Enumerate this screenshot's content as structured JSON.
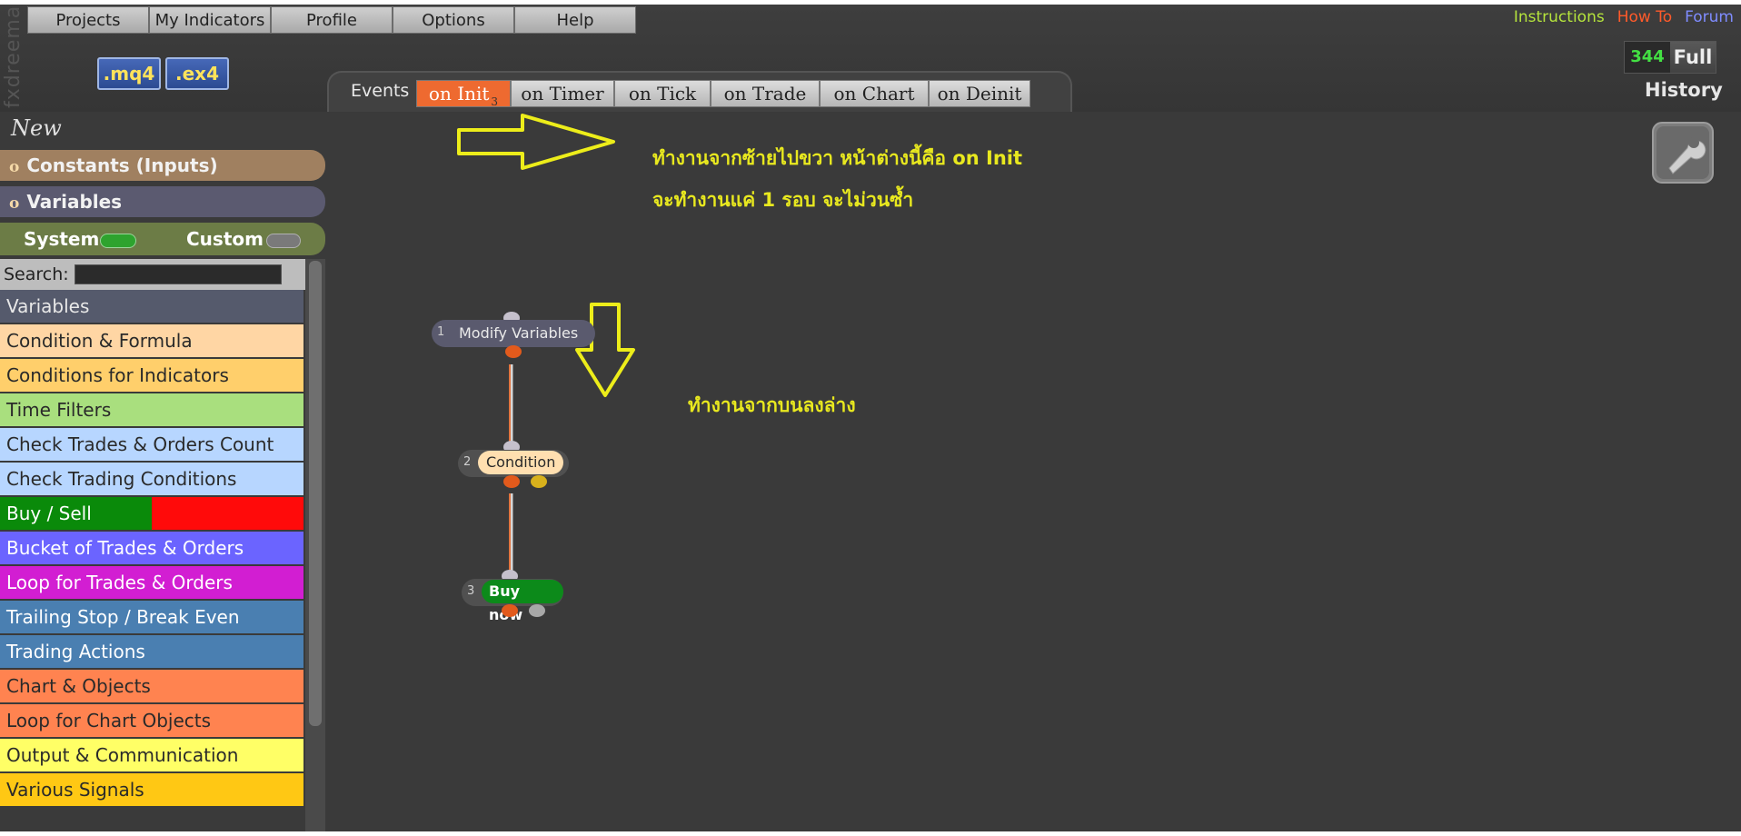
{
  "brand": "fxdreema",
  "menu": [
    "Projects",
    "My Indicators",
    "Profile",
    "Options",
    "Help"
  ],
  "format_buttons": [
    ".mq4",
    ".ex4"
  ],
  "top_links": [
    {
      "label": "Instructions",
      "color": "#b5e43c"
    },
    {
      "label": "How To",
      "color": "#ff5a2a"
    },
    {
      "label": "Forum",
      "color": "#7f8cff"
    }
  ],
  "counter": {
    "value": "344",
    "label": "Full"
  },
  "history_label": "History",
  "events": {
    "label": "Events",
    "tabs": [
      {
        "label": "on Init",
        "sub": "3",
        "active": true
      },
      {
        "label": "on Timer"
      },
      {
        "label": "on Tick"
      },
      {
        "label": "on Trade"
      },
      {
        "label": "on Chart"
      },
      {
        "label": "on Deinit"
      }
    ]
  },
  "sidebar": {
    "new_label": "New",
    "constants_label": "Constants (Inputs)",
    "variables_label": "Variables",
    "section_bullet": "o",
    "toggles": {
      "system": "System",
      "system_on": true,
      "custom": "Custom",
      "custom_on": false
    },
    "search": {
      "label": "Search:",
      "value": ""
    },
    "categories": [
      {
        "label": "Variables",
        "bg": "#555a6c",
        "color": "#e8e8e8"
      },
      {
        "label": "Condition & Formula",
        "bg": "#ffd6a4",
        "color": "#2a2a2a"
      },
      {
        "label": "Conditions for Indicators",
        "bg": "#ffcf6b",
        "color": "#2a2a2a"
      },
      {
        "label": "Time Filters",
        "bg": "#a9df7e",
        "color": "#2a2a2a"
      },
      {
        "label": "Check Trades & Orders Count",
        "bg": "#b7d6ff",
        "color": "#2a2a2a"
      },
      {
        "label": "Check Trading Conditions",
        "bg": "#b7d6ff",
        "color": "#2a2a2a"
      },
      {
        "label": "Buy / Sell",
        "bg": "#0a8a0a",
        "color": "#ffffff",
        "split_bg": "#ff0a0a"
      },
      {
        "label": "Bucket of Trades & Orders",
        "bg": "#6b64ff",
        "color": "#ffffff"
      },
      {
        "label": "Loop for Trades & Orders",
        "bg": "#d21ed2",
        "color": "#ffffff"
      },
      {
        "label": "Trailing Stop / Break Even",
        "bg": "#4a7fb1",
        "color": "#ffffff"
      },
      {
        "label": "Trading Actions",
        "bg": "#4a7fb1",
        "color": "#ffffff"
      },
      {
        "label": "Chart & Objects",
        "bg": "#ff8350",
        "color": "#2a2a2a"
      },
      {
        "label": "Loop for Chart Objects",
        "bg": "#ff8350",
        "color": "#2a2a2a"
      },
      {
        "label": "Output & Communication",
        "bg": "#ffff66",
        "color": "#2a2a2a"
      },
      {
        "label": "Various Signals",
        "bg": "#ffc814",
        "color": "#2a2a2a"
      }
    ]
  },
  "canvas": {
    "annotation_right": [
      "ทำงานจากซ้ายไปขวา หน้าต่างนี้คือ on Init",
      "จะทำงานแค่ 1 รอบ จะไม่วนซ้ำ"
    ],
    "annotation_down": "ทำงานจากบนลงล่าง",
    "nodes": [
      {
        "num": "1",
        "label": "Modify Variables"
      },
      {
        "num": "2",
        "label": "Condition"
      },
      {
        "num": "3",
        "label": "Buy now"
      }
    ],
    "annotation_color": "#e8e81f"
  }
}
